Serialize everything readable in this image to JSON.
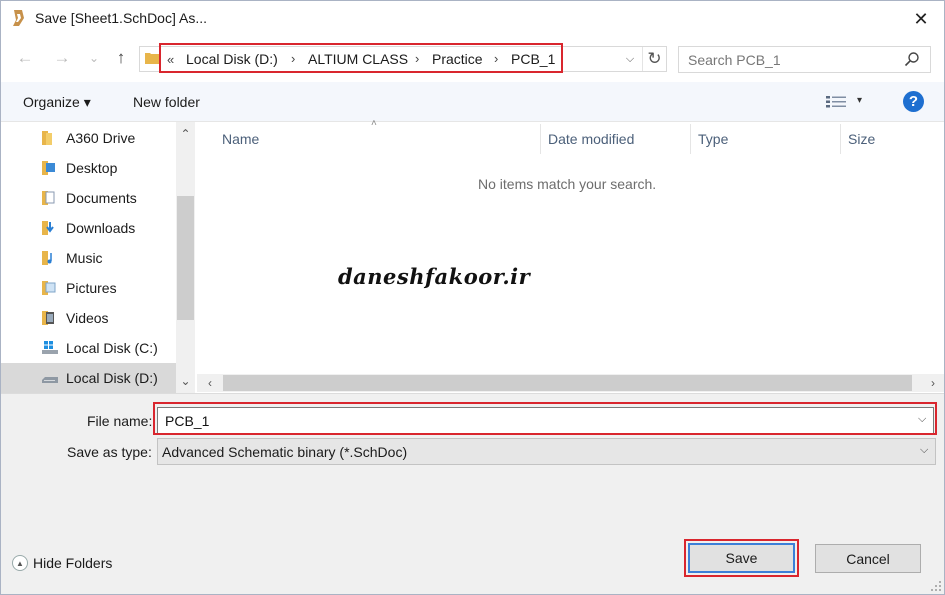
{
  "window": {
    "title": "Save [Sheet1.SchDoc] As...",
    "close_glyph": "✕"
  },
  "nav": {
    "back_glyph": "←",
    "forward_glyph": "→",
    "recent_glyph": "⌄",
    "up_glyph": "↑"
  },
  "address": {
    "overflow_glyph": "«",
    "crumbs": [
      "Local Disk (D:)",
      "ALTIUM CLASS",
      "Practice",
      "PCB_1"
    ],
    "separator": "›",
    "dropdown_glyph": "⌵",
    "refresh_glyph": "↻"
  },
  "search": {
    "placeholder": "Search PCB_1"
  },
  "toolbar": {
    "organize_label": "Organize ▾",
    "new_folder_label": "New folder",
    "view_dropdown_glyph": "▾",
    "help_glyph": "?"
  },
  "sidebar": {
    "items": [
      {
        "label": "A360 Drive",
        "icon": "folder-icon"
      },
      {
        "label": "Desktop",
        "icon": "desktop-folder-icon"
      },
      {
        "label": "Documents",
        "icon": "documents-icon"
      },
      {
        "label": "Downloads",
        "icon": "downloads-icon"
      },
      {
        "label": "Music",
        "icon": "music-icon"
      },
      {
        "label": "Pictures",
        "icon": "pictures-icon"
      },
      {
        "label": "Videos",
        "icon": "videos-icon"
      },
      {
        "label": "Local Disk (C:)",
        "icon": "windows-drive-icon"
      },
      {
        "label": "Local Disk (D:)",
        "icon": "drive-icon",
        "selected": true
      }
    ],
    "scroll_up_glyph": "⌃",
    "scroll_down_glyph": "⌄"
  },
  "filelist": {
    "columns": [
      "Name",
      "Date modified",
      "Type",
      "Size"
    ],
    "sort_glyph": "˄",
    "empty_message": "No items match your search.",
    "watermark": "daneshfakoor.ir",
    "scroll_left_glyph": "‹",
    "scroll_right_glyph": "›"
  },
  "form": {
    "file_name_label": "File name:",
    "file_name_value": "PCB_1",
    "save_as_type_label": "Save as type:",
    "save_as_type_value": "Advanced Schematic binary (*.SchDoc)",
    "dropdown_glyph": "⌵"
  },
  "footer": {
    "hide_folders_label": "Hide Folders",
    "hide_glyph": "▲",
    "save_label": "Save",
    "cancel_label": "Cancel"
  },
  "colors": {
    "highlight": "#d9262e",
    "accent": "#1e6fd0",
    "folder": "#e8b54a"
  }
}
